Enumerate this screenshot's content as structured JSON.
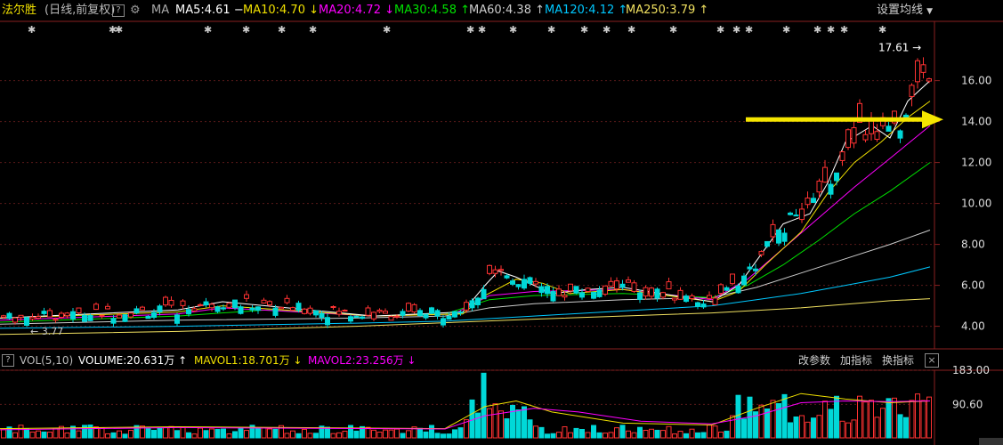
{
  "header": {
    "stock_name": "法尔胜",
    "mode": "(日线,前复权)",
    "ma_label": "MA",
    "ma_items": [
      {
        "text": "MA5:4.61 −",
        "color": "#ffffff"
      },
      {
        "text": "MA10:4.70 ↓",
        "color": "#f0e000"
      },
      {
        "text": "MA20:4.72 ↓",
        "color": "#ff00ff"
      },
      {
        "text": "MA30:4.58 ↑",
        "color": "#00e000"
      },
      {
        "text": "MA60:4.38 ↑",
        "color": "#cccccc"
      },
      {
        "text": "MA120:4.12 ↑",
        "color": "#00c8ff"
      },
      {
        "text": "MA250:3.79 ↑",
        "color": "#f0e060"
      }
    ],
    "settings_label": "设置均线"
  },
  "price_axis": {
    "ticks": [
      "16.00",
      "14.00",
      "12.00",
      "10.00",
      "8.00",
      "6.00",
      "4.00"
    ],
    "max_marker": "17.61",
    "min_marker": "3.77"
  },
  "volume_header": {
    "vol_label": "VOL(5,10)",
    "volume_text": "VOLUME:20.631万 ↑",
    "mavol1_text": "MAVOL1:18.701万 ↓",
    "mavol2_text": "MAVOL2:23.256万 ↓",
    "btn_params": "改参数",
    "btn_add": "加指标",
    "btn_switch": "换指标",
    "close": "×"
  },
  "volume_axis": {
    "ticks": [
      "183.00",
      "90.60"
    ]
  },
  "chart_data": {
    "type": "candlestick",
    "price_ylim": [
      3.2,
      18.2
    ],
    "volume_ylim": [
      0,
      183
    ],
    "arrow_level": 14.1,
    "ma_series": [
      {
        "period": "MA250",
        "color": "#f0e060",
        "values": [
          [
            0,
            3.6
          ],
          [
            200,
            3.75
          ],
          [
            400,
            4.0
          ],
          [
            600,
            4.35
          ],
          [
            800,
            4.65
          ],
          [
            900,
            4.9
          ],
          [
            1000,
            5.25
          ],
          [
            1045,
            5.35
          ]
        ]
      },
      {
        "period": "MA120",
        "color": "#00c8ff",
        "values": [
          [
            0,
            3.9
          ],
          [
            200,
            4.0
          ],
          [
            400,
            4.15
          ],
          [
            500,
            4.25
          ],
          [
            600,
            4.5
          ],
          [
            800,
            5.0
          ],
          [
            850,
            5.3
          ],
          [
            900,
            5.6
          ],
          [
            950,
            6.0
          ],
          [
            1000,
            6.4
          ],
          [
            1045,
            6.9
          ]
        ]
      },
      {
        "period": "MA60",
        "color": "#cccccc",
        "values": [
          [
            0,
            4.1
          ],
          [
            200,
            4.3
          ],
          [
            400,
            4.4
          ],
          [
            500,
            4.5
          ],
          [
            550,
            4.9
          ],
          [
            600,
            5.1
          ],
          [
            700,
            5.3
          ],
          [
            800,
            5.4
          ],
          [
            850,
            5.9
          ],
          [
            900,
            6.6
          ],
          [
            950,
            7.3
          ],
          [
            1000,
            8.0
          ],
          [
            1045,
            8.7
          ]
        ]
      },
      {
        "period": "MA30",
        "color": "#00e000",
        "values": [
          [
            0,
            4.2
          ],
          [
            200,
            4.5
          ],
          [
            300,
            4.8
          ],
          [
            420,
            4.5
          ],
          [
            500,
            4.6
          ],
          [
            550,
            5.3
          ],
          [
            600,
            5.5
          ],
          [
            700,
            5.6
          ],
          [
            800,
            5.4
          ],
          [
            840,
            6.0
          ],
          [
            880,
            7.0
          ],
          [
            920,
            8.2
          ],
          [
            960,
            9.5
          ],
          [
            1000,
            10.6
          ],
          [
            1045,
            12.0
          ]
        ]
      },
      {
        "period": "MA20",
        "color": "#ff00ff",
        "values": [
          [
            0,
            4.3
          ],
          [
            200,
            4.6
          ],
          [
            250,
            4.9
          ],
          [
            420,
            4.5
          ],
          [
            510,
            4.6
          ],
          [
            550,
            5.5
          ],
          [
            600,
            5.7
          ],
          [
            700,
            5.8
          ],
          [
            800,
            5.3
          ],
          [
            840,
            6.3
          ],
          [
            880,
            7.8
          ],
          [
            920,
            9.3
          ],
          [
            960,
            10.8
          ],
          [
            1000,
            12.2
          ],
          [
            1045,
            13.8
          ]
        ]
      },
      {
        "period": "MA10",
        "color": "#f0e000",
        "values": [
          [
            0,
            4.4
          ],
          [
            200,
            4.7
          ],
          [
            250,
            5.0
          ],
          [
            420,
            4.5
          ],
          [
            520,
            4.6
          ],
          [
            545,
            5.5
          ],
          [
            580,
            6.3
          ],
          [
            610,
            6.1
          ],
          [
            640,
            5.6
          ],
          [
            700,
            5.8
          ],
          [
            800,
            5.2
          ],
          [
            830,
            5.7
          ],
          [
            860,
            7.0
          ],
          [
            900,
            8.6
          ],
          [
            930,
            10.5
          ],
          [
            960,
            12.0
          ],
          [
            990,
            13.0
          ],
          [
            1020,
            14.2
          ],
          [
            1045,
            15.0
          ]
        ]
      },
      {
        "period": "MA5",
        "color": "#ffffff",
        "values": [
          [
            0,
            4.4
          ],
          [
            200,
            4.8
          ],
          [
            250,
            5.2
          ],
          [
            420,
            4.5
          ],
          [
            520,
            4.7
          ],
          [
            545,
            6.0
          ],
          [
            560,
            6.7
          ],
          [
            580,
            6.4
          ],
          [
            620,
            5.6
          ],
          [
            660,
            5.8
          ],
          [
            700,
            5.9
          ],
          [
            800,
            5.2
          ],
          [
            830,
            6.0
          ],
          [
            860,
            7.8
          ],
          [
            880,
            9.0
          ],
          [
            910,
            9.5
          ],
          [
            930,
            11.0
          ],
          [
            950,
            13.0
          ],
          [
            980,
            13.8
          ],
          [
            1000,
            13.2
          ],
          [
            1020,
            15.0
          ],
          [
            1045,
            16.0
          ]
        ]
      }
    ],
    "mavol_series": [
      {
        "name": "MAVOL1",
        "color": "#f0e000"
      },
      {
        "name": "MAVOL2",
        "color": "#ff00ff"
      }
    ]
  }
}
